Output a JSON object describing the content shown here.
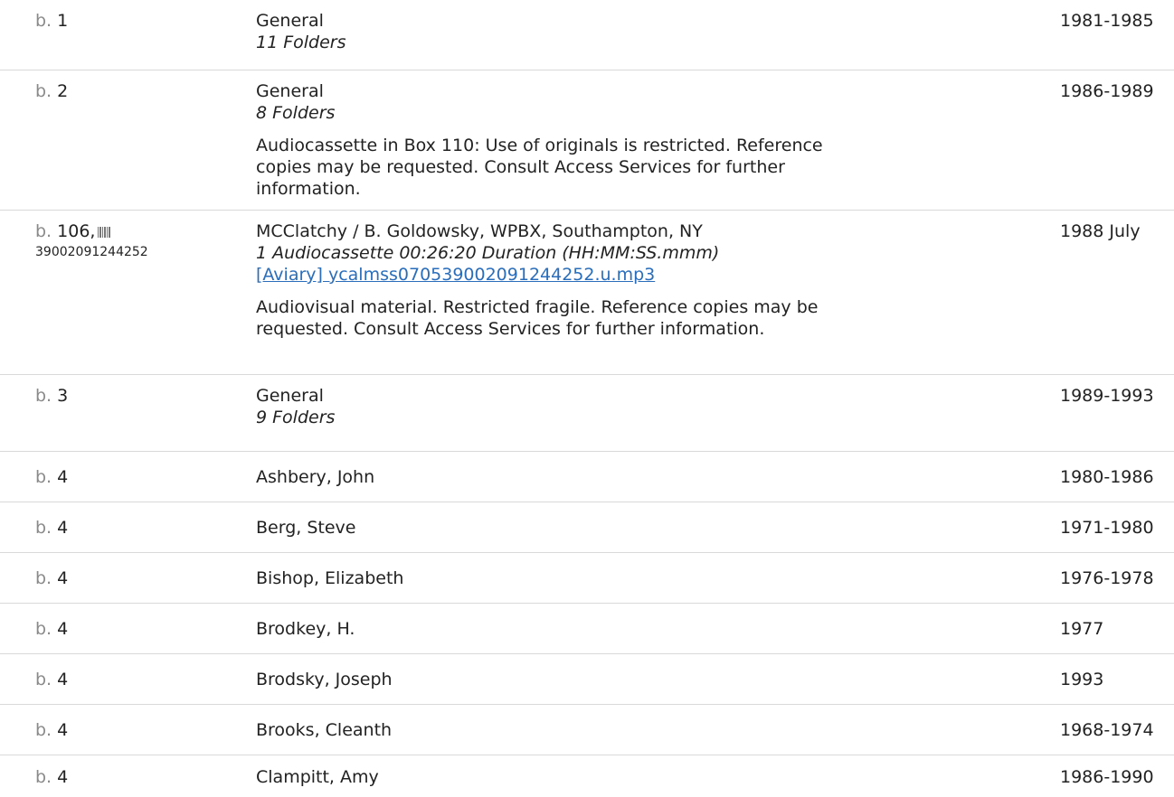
{
  "rows": [
    {
      "box_prefix": "b.",
      "box_num": "1",
      "title": "General",
      "extent": "11 Folders",
      "date": "1981-1985"
    },
    {
      "box_prefix": "b.",
      "box_num": "2",
      "title": "General",
      "extent": "8 Folders",
      "date": "1986-1989",
      "note": "Audiocassette in Box 110: Use of originals is restricted. Reference copies may be requested. Consult Access Services for further information."
    },
    {
      "box_prefix": "b.",
      "box_num": "106,",
      "barcode": "39002091244252",
      "barcode_icon": "barcode-icon",
      "title": "MCClatchy / B. Goldowsky, WPBX, Southampton, NY",
      "extent": "1 Audiocassette  00:26:20 Duration (HH:MM:SS.mmm)",
      "link": "[Aviary] ycalmss0705390020912442 52.u.mp3",
      "link_text": "[Aviary] ycalmss070539002091244252.u.mp3",
      "note": "Audiovisual material. Restricted fragile. Reference copies may be requested. Consult Access Services for further information.",
      "date": "1988 July"
    },
    {
      "box_prefix": "b.",
      "box_num": "3",
      "title": "General",
      "extent": "9 Folders",
      "date": "1989-1993"
    },
    {
      "box_prefix": "b.",
      "box_num": "4",
      "title": "Ashbery, John",
      "date": "1980-1986"
    },
    {
      "box_prefix": "b.",
      "box_num": "4",
      "title": "Berg, Steve",
      "date": "1971-1980"
    },
    {
      "box_prefix": "b.",
      "box_num": "4",
      "title": "Bishop, Elizabeth",
      "date": "1976-1978"
    },
    {
      "box_prefix": "b.",
      "box_num": "4",
      "title": "Brodkey, H.",
      "date": "1977"
    },
    {
      "box_prefix": "b.",
      "box_num": "4",
      "title": "Brodsky, Joseph",
      "date": "1993"
    },
    {
      "box_prefix": "b.",
      "box_num": "4",
      "title": "Brooks, Cleanth",
      "date": "1968-1974"
    },
    {
      "box_prefix": "b.",
      "box_num": "4",
      "title": "Clampitt, Amy",
      "date": "1986-1990"
    }
  ],
  "colors": {
    "link": "#2a6ebb",
    "prefix": "#8a8a8a",
    "divider": "#d9d9d9"
  }
}
